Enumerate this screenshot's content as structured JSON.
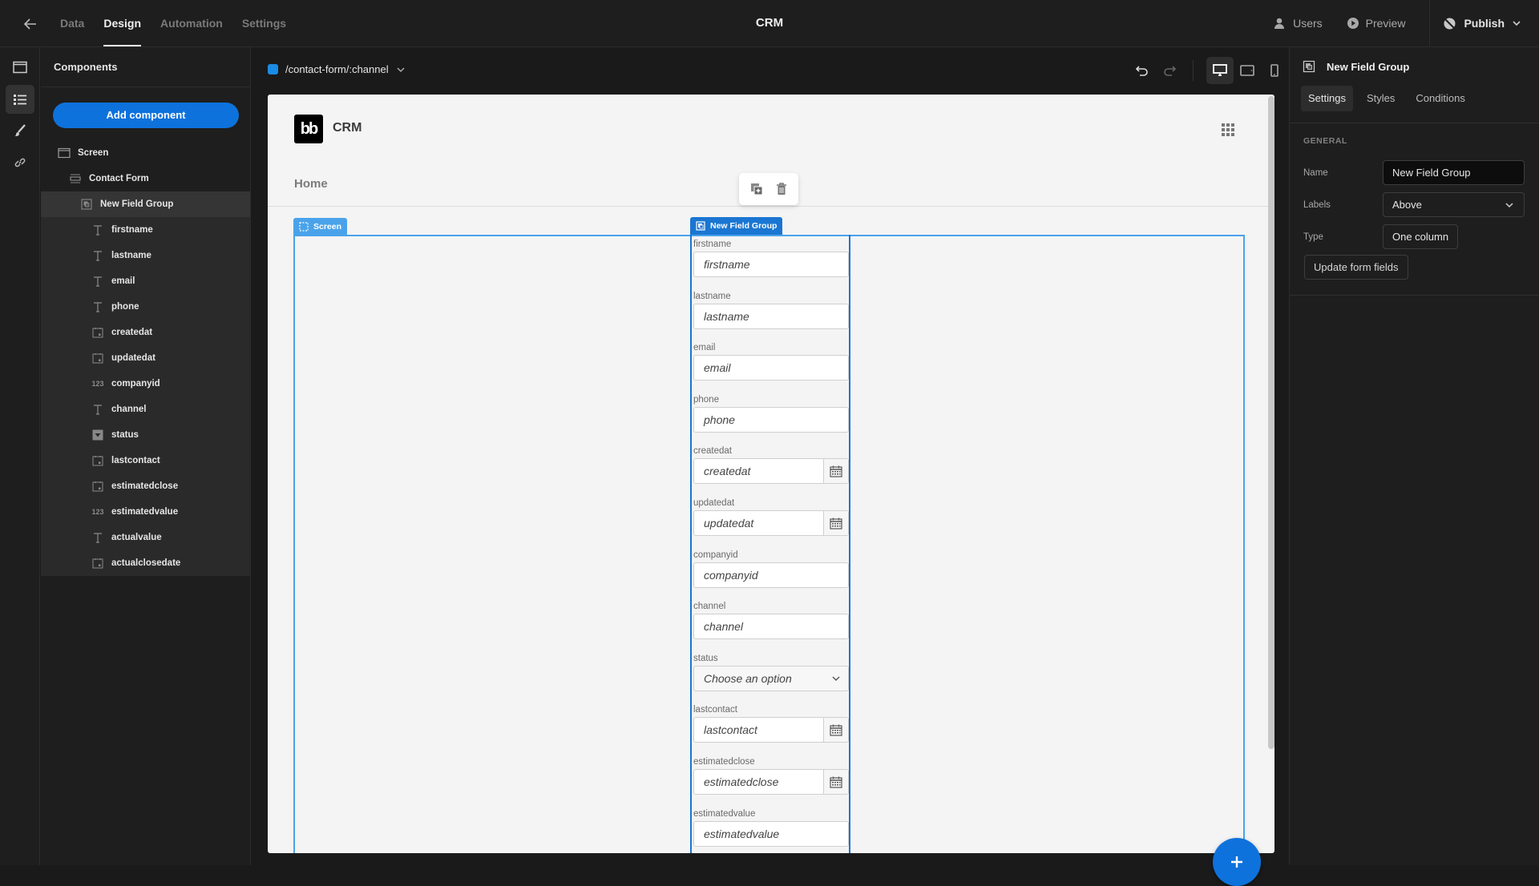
{
  "topbar": {
    "nav": [
      {
        "label": "Data",
        "active": false
      },
      {
        "label": "Design",
        "active": true
      },
      {
        "label": "Automation",
        "active": false
      },
      {
        "label": "Settings",
        "active": false
      }
    ],
    "app_title": "CRM",
    "users_label": "Users",
    "preview_label": "Preview",
    "publish_label": "Publish"
  },
  "components_panel": {
    "title": "Components",
    "add_button": "Add component",
    "tree": [
      {
        "label": "Screen",
        "icon": "screen-icon",
        "depth": 0
      },
      {
        "label": "Contact Form",
        "icon": "form-icon",
        "depth": 1
      },
      {
        "label": "New Field Group",
        "icon": "field-group-icon",
        "depth": 2,
        "selected": true
      },
      {
        "label": "firstname",
        "icon": "text-field-icon",
        "depth": 3
      },
      {
        "label": "lastname",
        "icon": "text-field-icon",
        "depth": 3
      },
      {
        "label": "email",
        "icon": "text-field-icon",
        "depth": 3
      },
      {
        "label": "phone",
        "icon": "text-field-icon",
        "depth": 3
      },
      {
        "label": "createdat",
        "icon": "date-field-icon",
        "depth": 3
      },
      {
        "label": "updatedat",
        "icon": "date-field-icon",
        "depth": 3
      },
      {
        "label": "companyid",
        "icon": "number-field-icon",
        "depth": 3
      },
      {
        "label": "channel",
        "icon": "text-field-icon",
        "depth": 3
      },
      {
        "label": "status",
        "icon": "options-field-icon",
        "depth": 3
      },
      {
        "label": "lastcontact",
        "icon": "date-field-icon",
        "depth": 3
      },
      {
        "label": "estimatedclose",
        "icon": "date-field-icon",
        "depth": 3
      },
      {
        "label": "estimatedvalue",
        "icon": "number-field-icon",
        "depth": 3
      },
      {
        "label": "actualvalue",
        "icon": "text-field-icon",
        "depth": 3
      },
      {
        "label": "actualclosedate",
        "icon": "date-field-icon",
        "depth": 3
      }
    ]
  },
  "workspace": {
    "route": "/contact-form/:channel",
    "route_color": "#1a8ce6"
  },
  "canvas": {
    "logo_text": "bb",
    "app_name": "CRM",
    "nav_home": "Home",
    "screen_tag": "Screen",
    "field_group_tag": "New Field Group",
    "fields": [
      {
        "label": "firstname",
        "placeholder": "firstname",
        "type": "text"
      },
      {
        "label": "lastname",
        "placeholder": "lastname",
        "type": "text"
      },
      {
        "label": "email",
        "placeholder": "email",
        "type": "text"
      },
      {
        "label": "phone",
        "placeholder": "phone",
        "type": "text"
      },
      {
        "label": "createdat",
        "placeholder": "createdat",
        "type": "date"
      },
      {
        "label": "updatedat",
        "placeholder": "updatedat",
        "type": "date"
      },
      {
        "label": "companyid",
        "placeholder": "companyid",
        "type": "text"
      },
      {
        "label": "channel",
        "placeholder": "channel",
        "type": "text"
      },
      {
        "label": "status",
        "placeholder": "Choose an option",
        "type": "select"
      },
      {
        "label": "lastcontact",
        "placeholder": "lastcontact",
        "type": "date"
      },
      {
        "label": "estimatedclose",
        "placeholder": "estimatedclose",
        "type": "date"
      },
      {
        "label": "estimatedvalue",
        "placeholder": "estimatedvalue",
        "type": "text"
      }
    ]
  },
  "props_panel": {
    "title": "New Field Group",
    "tabs": [
      {
        "label": "Settings",
        "active": true
      },
      {
        "label": "Styles",
        "active": false
      },
      {
        "label": "Conditions",
        "active": false
      }
    ],
    "section": "GENERAL",
    "name_label": "Name",
    "name_value": "New Field Group",
    "labels_label": "Labels",
    "labels_value": "Above",
    "type_label": "Type",
    "type_value": "One column",
    "update_button": "Update form fields"
  },
  "colors": {
    "accent": "#0e72dc",
    "screen_outline": "#4aa3ea",
    "field_group_outline": "#1a76d2"
  }
}
